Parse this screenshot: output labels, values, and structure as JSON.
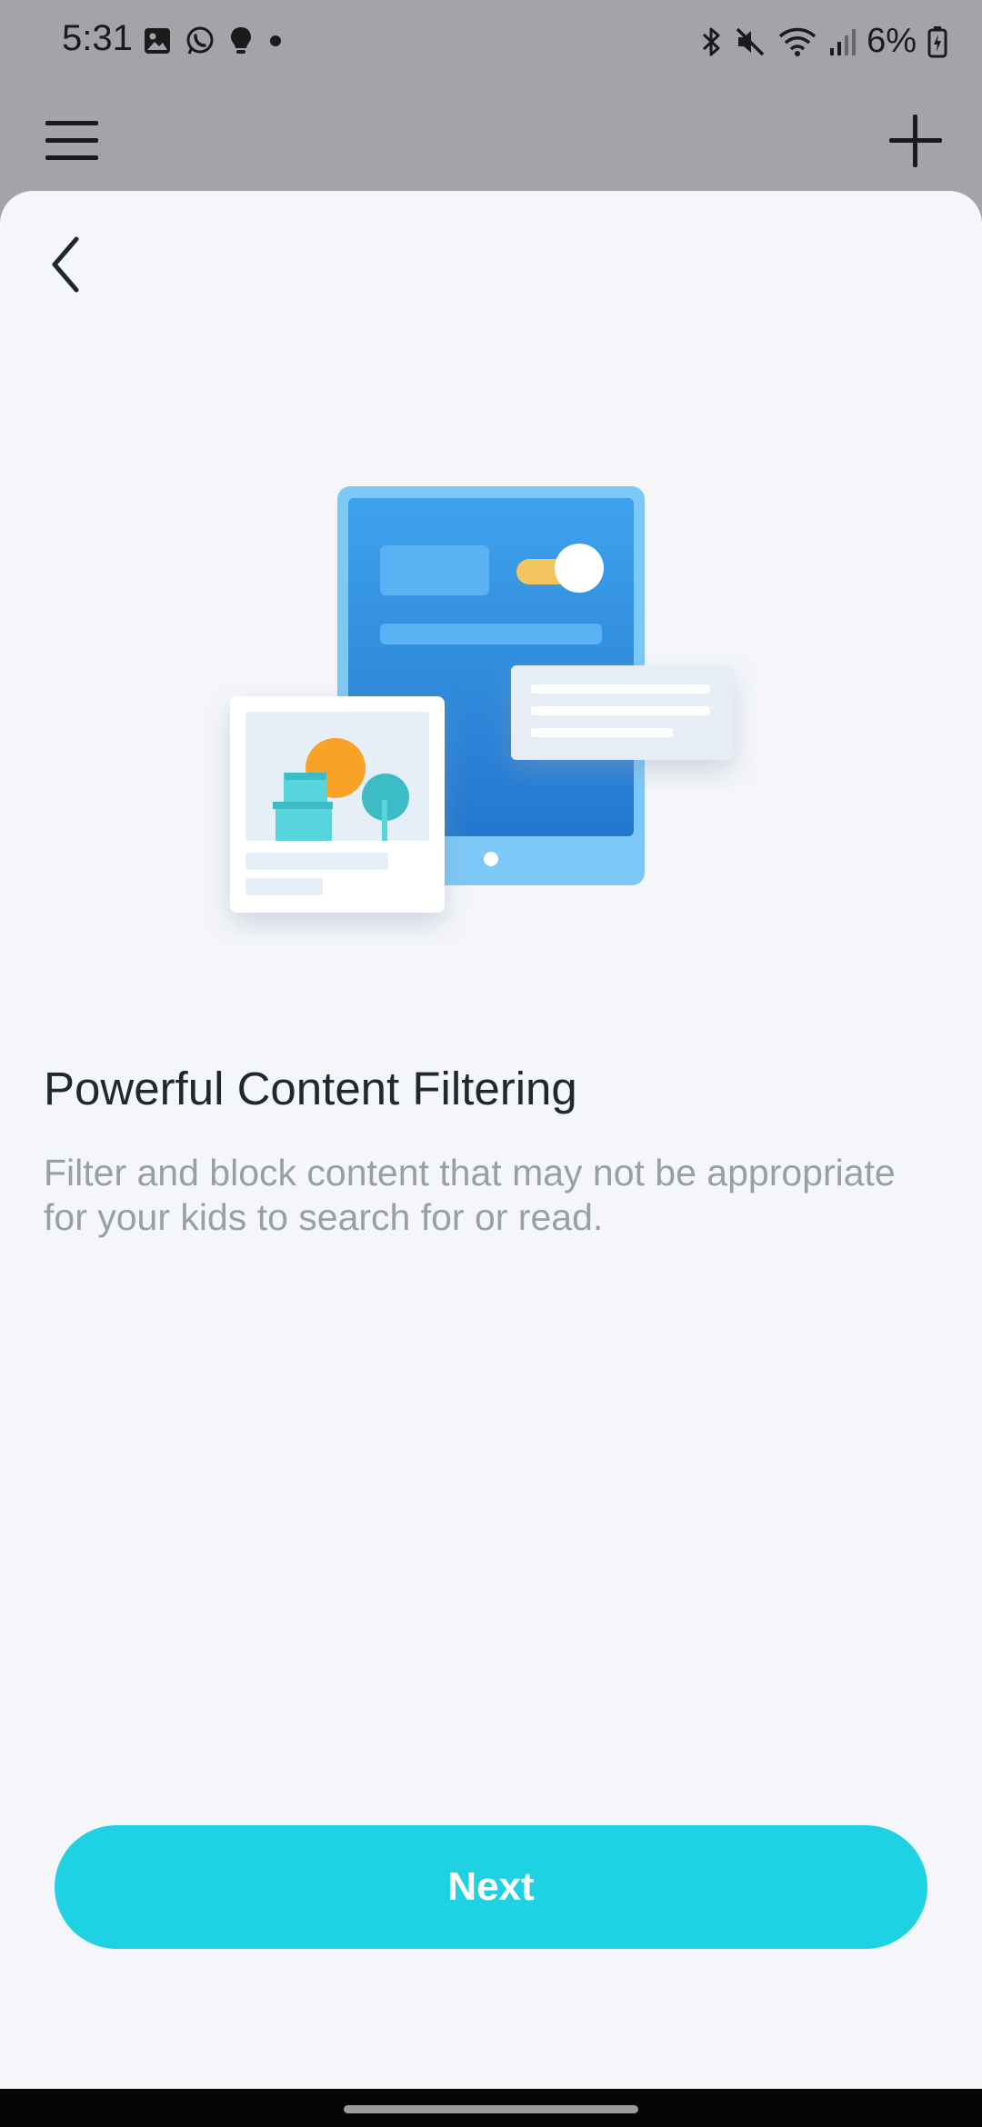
{
  "status_bar": {
    "time": "5:31",
    "battery": "6%",
    "left_icons": [
      "gallery-icon",
      "whatsapp-icon",
      "bulb-icon",
      "dot-icon"
    ],
    "right_icons": [
      "bluetooth-icon",
      "mute-icon",
      "wifi-icon",
      "signal-icon",
      "battery-icon"
    ]
  },
  "app_bar": {
    "left_icon": "menu-icon",
    "right_icon": "plus-icon"
  },
  "sheet": {
    "back_icon": "back-arrow-icon",
    "title": "Powerful Content Filtering",
    "description": "Filter and block content that may not be appropriate for your kids to search for or read.",
    "next_label": "Next"
  },
  "colors": {
    "accent": "#1ed2e3",
    "sheet_bg": "#f4f6fa",
    "dim_bg": "#a3a4a7",
    "title": "#22262e",
    "description": "#9a9ea6"
  }
}
